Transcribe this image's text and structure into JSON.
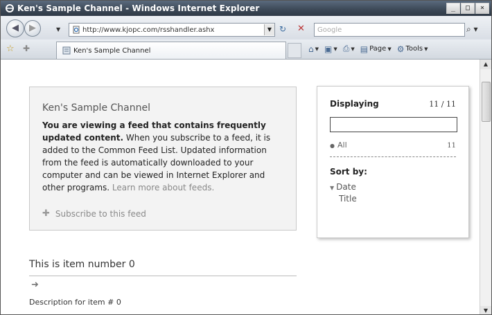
{
  "window": {
    "title": "Ken's Sample Channel - Windows Internet Explorer"
  },
  "nav": {
    "url": "http://www.kjopc.com/rsshandler.ashx",
    "search_placeholder": "Google"
  },
  "tabs": [
    {
      "label": "Ken's Sample Channel"
    }
  ],
  "commands": {
    "page": "Page",
    "tools": "Tools"
  },
  "feed": {
    "title": "Ken's Sample Channel",
    "intro_bold": "You are viewing a feed that contains frequently updated content.",
    "intro_rest": " When you subscribe to a feed, it is added to the Common Feed List. Updated information from the feed is automatically downloaded to your computer and can be viewed in Internet Explorer and other programs. ",
    "learn_more": "Learn more about feeds.",
    "subscribe": "Subscribe to this feed"
  },
  "sidebar": {
    "displaying_label": "Displaying",
    "count": "11 / 11",
    "filter_value": "",
    "all_label": "All",
    "all_count": "11",
    "sort_label": "Sort by:",
    "sort_options": [
      "Date",
      "Title"
    ]
  },
  "items": [
    {
      "title": "This is item number 0",
      "description": "Description for item # 0"
    }
  ]
}
